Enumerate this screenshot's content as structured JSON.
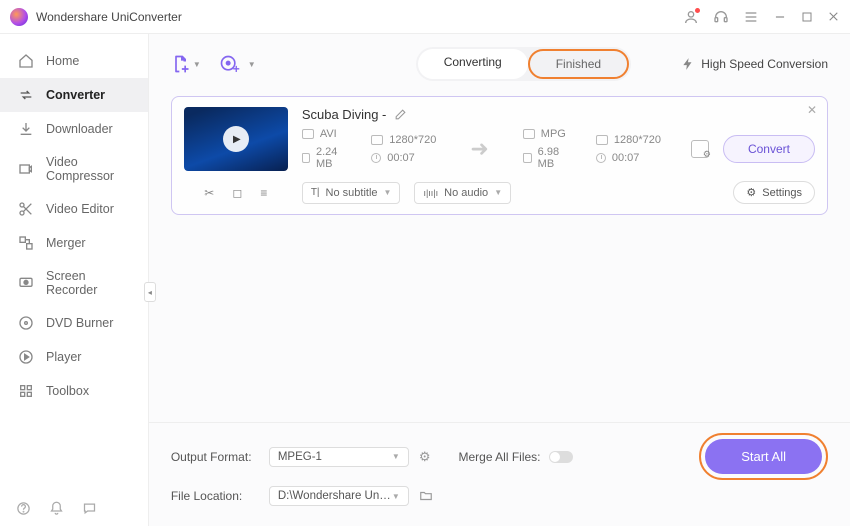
{
  "app": {
    "title": "Wondershare UniConverter"
  },
  "titlebar_icons": [
    "user",
    "headset",
    "menu",
    "min",
    "max",
    "close"
  ],
  "sidebar": {
    "items": [
      {
        "icon": "home",
        "label": "Home"
      },
      {
        "icon": "convert",
        "label": "Converter"
      },
      {
        "icon": "download",
        "label": "Downloader"
      },
      {
        "icon": "compress",
        "label": "Video Compressor"
      },
      {
        "icon": "scissors",
        "label": "Video Editor"
      },
      {
        "icon": "merge",
        "label": "Merger"
      },
      {
        "icon": "record",
        "label": "Screen Recorder"
      },
      {
        "icon": "dvd",
        "label": "DVD Burner"
      },
      {
        "icon": "play",
        "label": "Player"
      },
      {
        "icon": "grid",
        "label": "Toolbox"
      }
    ],
    "active_index": 1
  },
  "tabs": {
    "converting": "Converting",
    "finished": "Finished",
    "active": "finished"
  },
  "hsc_label": "High Speed Conversion",
  "job": {
    "title": "Scuba Diving -",
    "src": {
      "format": "AVI",
      "res": "1280*720",
      "size": "2.24 MB",
      "dur": "00:07"
    },
    "dst": {
      "format": "MPG",
      "res": "1280*720",
      "size": "6.98 MB",
      "dur": "00:07"
    },
    "subtitle": "No subtitle",
    "audio": "No audio",
    "settings": "Settings",
    "convert": "Convert"
  },
  "footer": {
    "out_fmt_label": "Output Format:",
    "out_fmt_value": "MPEG-1",
    "loc_label": "File Location:",
    "loc_value": "D:\\Wondershare UniConverter",
    "merge_label": "Merge All Files:",
    "start": "Start All"
  }
}
